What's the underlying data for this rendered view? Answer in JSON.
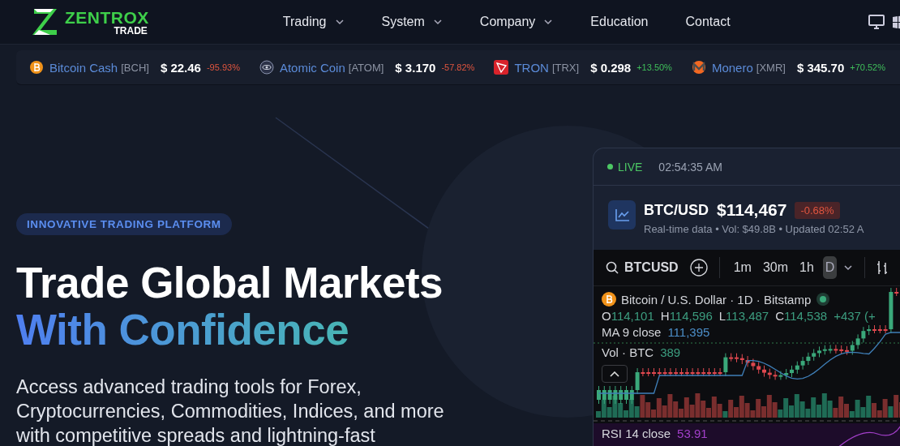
{
  "header": {
    "logo": {
      "name": "ZENTROX",
      "sub": "TRADE"
    },
    "nav": [
      {
        "label": "Trading",
        "dropdown": true
      },
      {
        "label": "System",
        "dropdown": true
      },
      {
        "label": "Company",
        "dropdown": true
      },
      {
        "label": "Education",
        "dropdown": false
      },
      {
        "label": "Contact",
        "dropdown": false
      }
    ]
  },
  "ticker": [
    {
      "kind": "bch",
      "name": "Bitcoin Cash",
      "symbol": "[BCH]",
      "price": "$ 22.46",
      "change": "-95.93%",
      "color": "#e0553f"
    },
    {
      "kind": "atom",
      "name": "Atomic Coin",
      "symbol": "[ATOM]",
      "price": "$ 3.170",
      "change": "-57.82%",
      "color": "#e0553f"
    },
    {
      "kind": "trx",
      "name": "TRON",
      "symbol": "[TRX]",
      "price": "$ 0.298",
      "change": "+13.50%",
      "color": "#3fbf5a"
    },
    {
      "kind": "xmr",
      "name": "Monero",
      "symbol": "[XMR]",
      "price": "$ 345.70",
      "change": "+70.52%",
      "color": "#3fbf5a"
    }
  ],
  "hero": {
    "badge": "INNOVATIVE TRADING PLATFORM",
    "title": "Trade Global Markets",
    "title_accent": "With Confidence",
    "text": "Access advanced trading tools for Forex, Cryptocurrencies, Commodities, Indices, and more with competitive spreads and lightning-fast"
  },
  "market_card": {
    "status": "LIVE",
    "time": "02:54:35 AM",
    "pair": "BTC/USD",
    "price": "$114,467",
    "change": "-0.68%",
    "info": "Real-time data • Vol: $49.8B • Updated 02:52 A",
    "chart": {
      "symbol": "BTCUSD",
      "intervals": [
        {
          "label": "1m",
          "selected": false
        },
        {
          "label": "30m",
          "selected": false
        },
        {
          "label": "1h",
          "selected": false
        },
        {
          "label": "D",
          "selected": true
        }
      ],
      "title": "Bitcoin / U.S. Dollar · 1D · Bitstamp",
      "ohlc": [
        {
          "key": "O",
          "value": "114,101"
        },
        {
          "key": "H",
          "value": "114,596"
        },
        {
          "key": "L",
          "value": "113,487"
        },
        {
          "key": "C",
          "value": "114,538"
        }
      ],
      "change": "+437 (+",
      "ma": {
        "label": "MA 9 close",
        "value": "111,395"
      },
      "volume": {
        "label": "Vol · BTC",
        "value": "389"
      },
      "rsi": {
        "label": "RSI 14 close",
        "value": "53.91"
      }
    }
  }
}
